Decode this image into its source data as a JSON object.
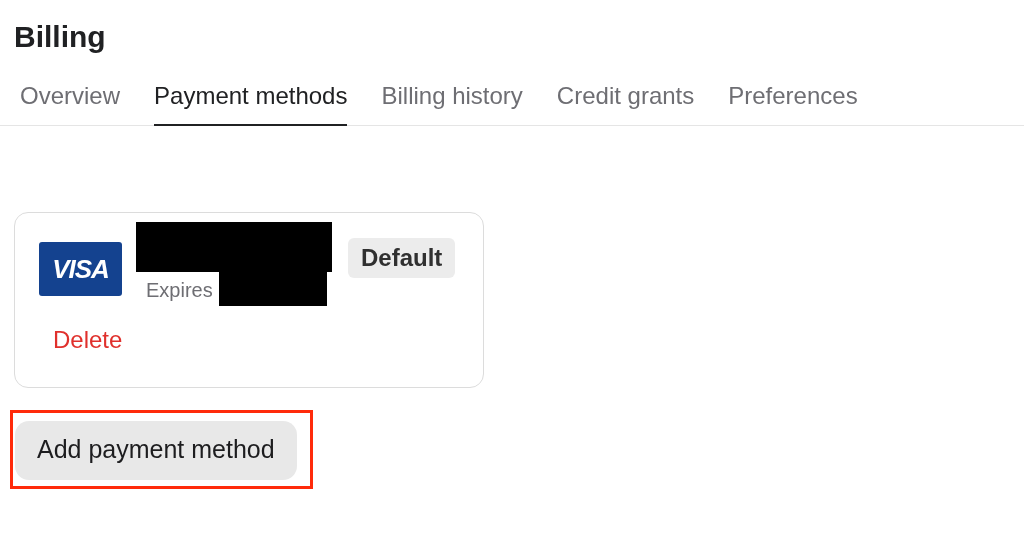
{
  "page": {
    "title": "Billing"
  },
  "tabs": [
    {
      "label": "Overview",
      "selected": false
    },
    {
      "label": "Payment methods",
      "selected": true
    },
    {
      "label": "Billing history",
      "selected": false
    },
    {
      "label": "Credit grants",
      "selected": false
    },
    {
      "label": "Preferences",
      "selected": false
    }
  ],
  "payment_methods": [
    {
      "brand_logo": "VISA",
      "number_redacted": true,
      "expires_label": "Expires",
      "expiry_redacted": true,
      "default_badge": "Default",
      "delete_link": "Delete"
    }
  ],
  "add_button": {
    "label": "Add payment method",
    "highlighted": true
  }
}
